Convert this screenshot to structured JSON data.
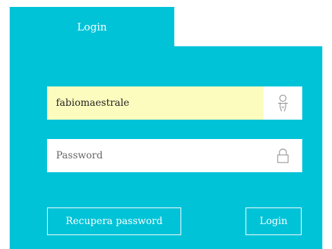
{
  "tabs": [
    {
      "label": "Login",
      "active": true
    }
  ],
  "form": {
    "username_value": "fabiomaestrale",
    "username_icon": "user-icon",
    "password_placeholder": "Password",
    "password_icon": "lock-icon",
    "recover_label": "Recupera password",
    "login_label": "Login"
  },
  "colors": {
    "accent": "#00c3d8",
    "autofill": "#fcfcbf",
    "text": "#ffffff"
  }
}
